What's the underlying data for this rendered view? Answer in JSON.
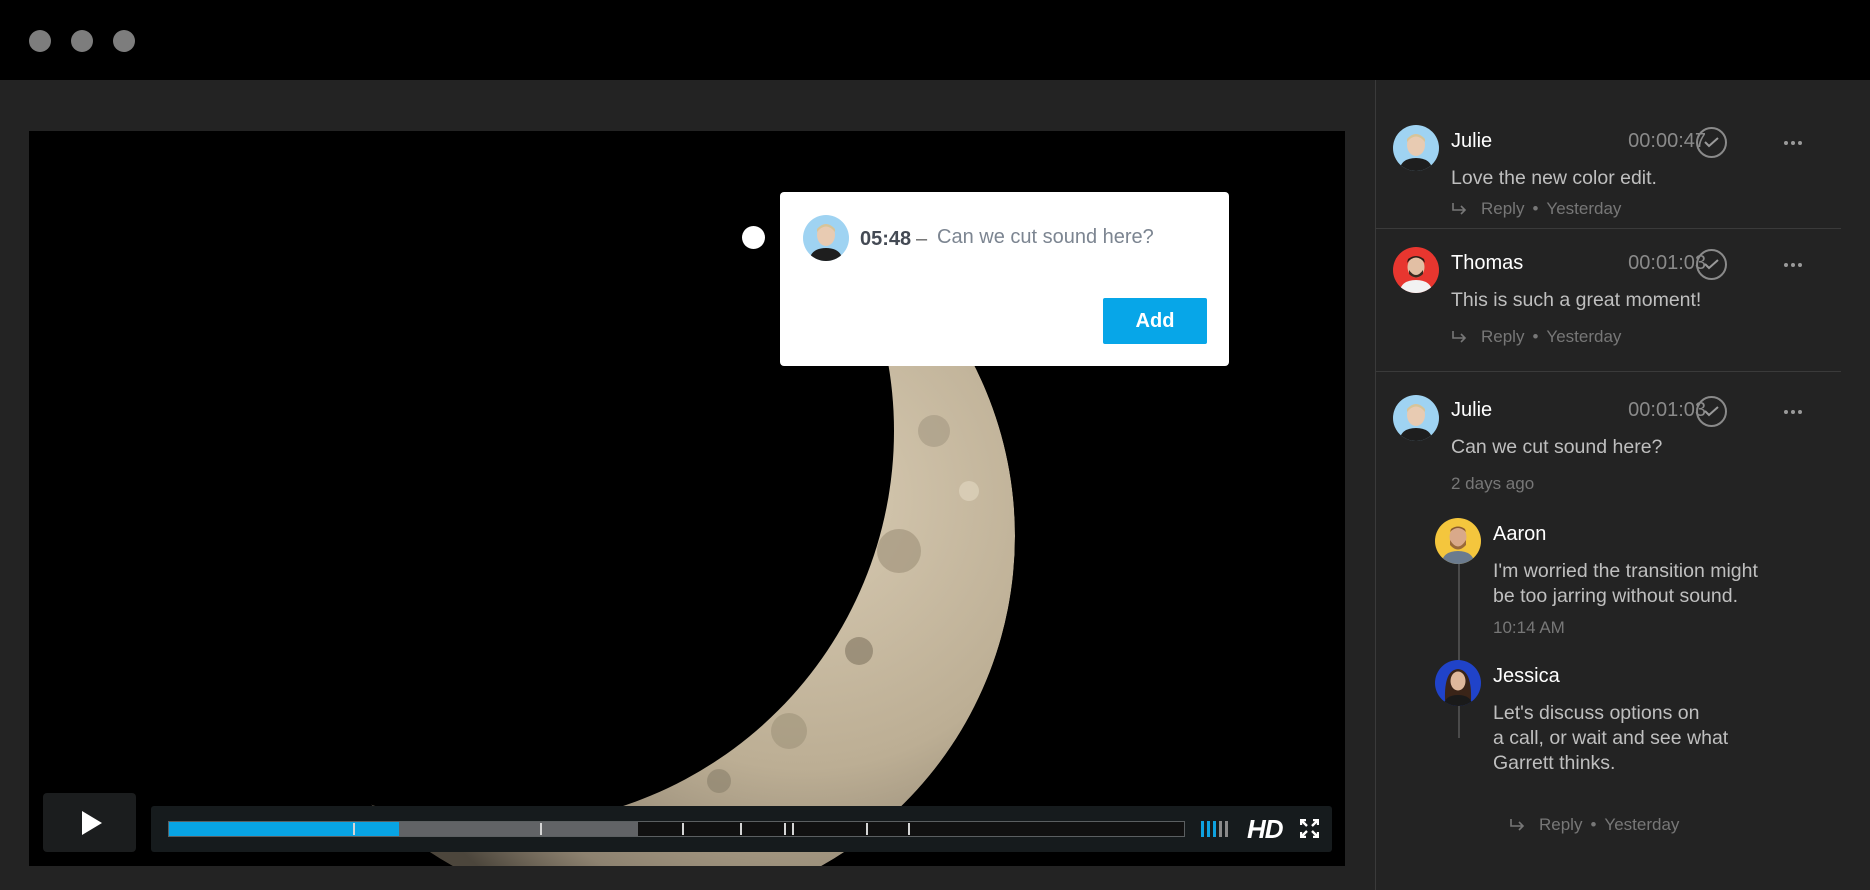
{
  "window": {
    "controls": [
      "close-dot",
      "minimize-dot",
      "maximize-dot"
    ]
  },
  "video": {
    "annotation_popup": {
      "timestamp": "05:48",
      "separator": "–",
      "text": "Can we cut sound here?",
      "add_label": "Add"
    },
    "player": {
      "progress_fraction": 0.227,
      "buffered_fraction": 0.462,
      "hd_label": "HD"
    }
  },
  "comments": [
    {
      "author": "Julie",
      "timecode": "00:00:47",
      "text": "Love the new color edit.",
      "reply_label": "Reply",
      "date": "Yesterday",
      "avatar_color": "#9fd3f2"
    },
    {
      "author": "Thomas",
      "timecode": "00:01:03",
      "text": "This is such a great moment!",
      "reply_label": "Reply",
      "date": "Yesterday",
      "avatar_color": "#e8362f"
    },
    {
      "author": "Julie",
      "timecode": "00:01:03",
      "text": "Can we cut sound here?",
      "date": "2 days ago",
      "avatar_color": "#9fd3f2",
      "replies": [
        {
          "author": "Aaron",
          "text_line1": "I'm worried the transition might",
          "text_line2": "be too jarring without sound.",
          "time": "10:14 AM",
          "avatar_color": "#f4c63d"
        },
        {
          "author": "Jessica",
          "text_line1": "Let's discuss options on",
          "text_line2": "a call, or wait and see what",
          "text_line3": "Garrett thinks.",
          "avatar_color": "#2043c9"
        }
      ],
      "reply_label": "Reply",
      "reply_date": "Yesterday"
    }
  ]
}
